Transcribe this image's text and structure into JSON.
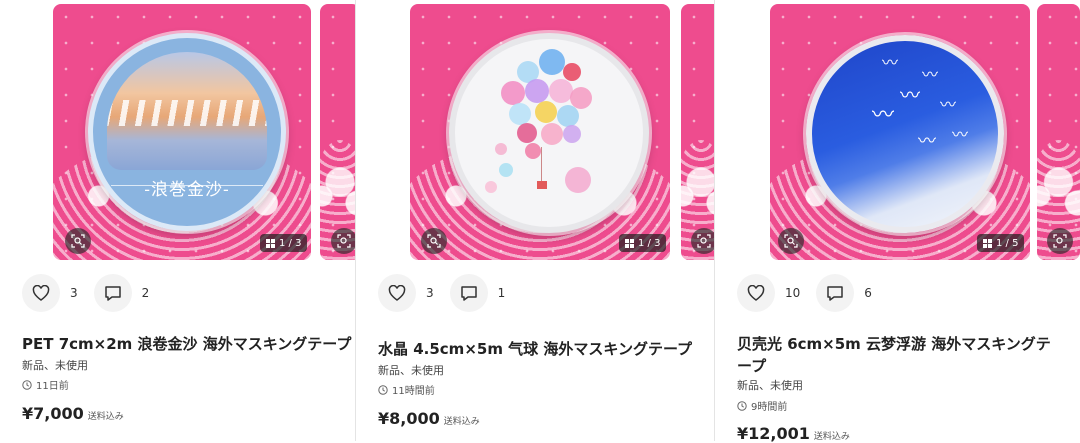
{
  "colors": {
    "photo_bg": "#ee4c8e",
    "pill_bg": "#f3f3f3",
    "text": "#222222"
  },
  "listings": [
    {
      "title": "PET 7cm×2m 浪卷金沙 海外マスキングテープ",
      "tape_label": "-浪巻金沙-",
      "condition": "新品、未使用",
      "time": "11日前",
      "price": "¥7,000",
      "shipping": "送料込み",
      "likes": "3",
      "comments": "2",
      "photo_counter": "1 / 3"
    },
    {
      "title": "水晶 4.5cm×5m 气球 海外マスキングテープ",
      "condition": "新品、未使用",
      "time": "11時間前",
      "price": "¥8,000",
      "shipping": "送料込み",
      "likes": "3",
      "comments": "1",
      "photo_counter": "1 / 3"
    },
    {
      "title": "贝壳光 6cm×5m 云梦浮游 海外マスキングテープ",
      "condition": "新品、未使用",
      "time": "9時間前",
      "price": "¥12,001",
      "shipping": "送料込み",
      "likes": "10",
      "comments": "6",
      "photo_counter": "1 / 5"
    }
  ],
  "icons": {
    "like": "heart-icon",
    "comment": "comment-icon",
    "zoom": "image-search-icon",
    "gallery": "grid-icon",
    "time": "clock-icon"
  }
}
